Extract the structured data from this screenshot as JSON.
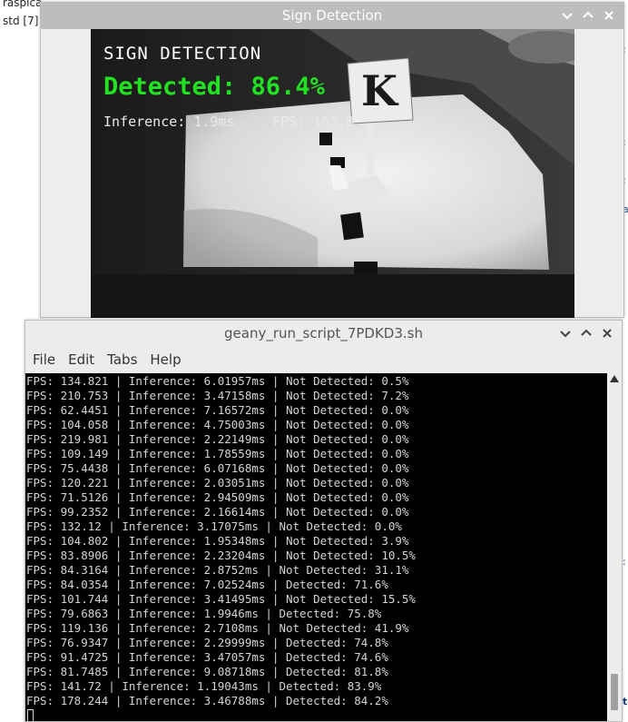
{
  "desktop": {
    "text1": "raspica",
    "text2": "std [7]"
  },
  "sign_window": {
    "title": "Sign Detection",
    "overlay": {
      "heading": "SIGN DETECTION",
      "detected": "Detected: 86.4%",
      "inference": "Inference: 1.9ms",
      "fps": "FPS: 103.8"
    },
    "sign_letter": "K"
  },
  "terminal_window": {
    "title": "geany_run_script_7PDKD3.sh",
    "menu": [
      "File",
      "Edit",
      "Tabs",
      "Help"
    ],
    "lines": [
      "FPS: 134.821 | Inference: 6.01957ms | Not Detected: 0.5%",
      "FPS: 210.753 | Inference: 3.47158ms | Not Detected: 7.2%",
      "FPS: 62.4451 | Inference: 7.16572ms | Not Detected: 0.0%",
      "FPS: 104.058 | Inference: 4.75003ms | Not Detected: 0.0%",
      "FPS: 219.981 | Inference: 2.22149ms | Not Detected: 0.0%",
      "FPS: 109.149 | Inference: 1.78559ms | Not Detected: 0.0%",
      "FPS: 75.4438 | Inference: 6.07168ms | Not Detected: 0.0%",
      "FPS: 120.221 | Inference: 2.03051ms | Not Detected: 0.0%",
      "FPS: 71.5126 | Inference: 2.94509ms | Not Detected: 0.0%",
      "FPS: 99.2352 | Inference: 2.16614ms | Not Detected: 0.0%",
      "FPS: 132.12 | Inference: 3.17075ms | Not Detected: 0.0%",
      "FPS: 104.802 | Inference: 1.95348ms | Not Detected: 3.9%",
      "FPS: 83.8906 | Inference: 2.23204ms | Not Detected: 10.5%",
      "FPS: 84.3164 | Inference: 2.8752ms | Not Detected: 31.1%",
      "FPS: 84.0354 | Inference: 7.02524ms | Detected: 71.6%",
      "FPS: 101.744 | Inference: 3.41495ms | Not Detected: 15.5%",
      "FPS: 79.6863 | Inference: 1.9946ms | Detected: 75.8%",
      "FPS: 119.136 | Inference: 2.7108ms | Not Detected: 41.9%",
      "FPS: 76.9347 | Inference: 2.29999ms | Detected: 74.8%",
      "FPS: 91.4725 | Inference: 3.47057ms | Detected: 74.6%",
      "FPS: 81.7485 | Inference: 9.08718ms | Detected: 81.8%",
      "FPS: 141.72 | Inference: 1.19043ms | Detected: 83.9%",
      "FPS: 178.244 | Inference: 3.46788ms | Detected: 84.2%"
    ]
  },
  "colors": {
    "detected_green": "#22e022",
    "terminal_bg": "#000000",
    "terminal_fg": "#d4d4d4"
  }
}
